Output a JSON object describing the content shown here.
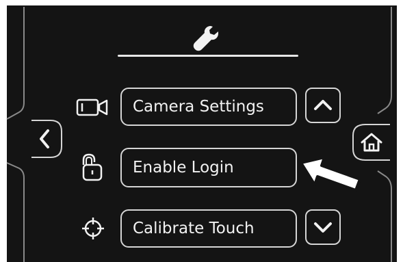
{
  "header": {
    "icon": "wrench-icon"
  },
  "navigation": {
    "back_icon": "chevron-left-icon",
    "home_icon": "home-icon"
  },
  "menu": {
    "items": [
      {
        "label": "Camera Settings",
        "icon": "camera-icon"
      },
      {
        "label": "Enable Login",
        "icon": "lock-icon"
      },
      {
        "label": "Calibrate Touch",
        "icon": "crosshair-icon"
      }
    ],
    "scroll_up_icon": "chevron-up-icon",
    "scroll_down_icon": "chevron-down-icon"
  },
  "annotation": {
    "pointer_icon": "arrow-pointer-icon",
    "points_to": "Enable Login"
  },
  "colors": {
    "screen_background": "#141414",
    "outline": "#d6d6d6",
    "text": "#f2f2f2",
    "page_background": "#ffffff"
  }
}
